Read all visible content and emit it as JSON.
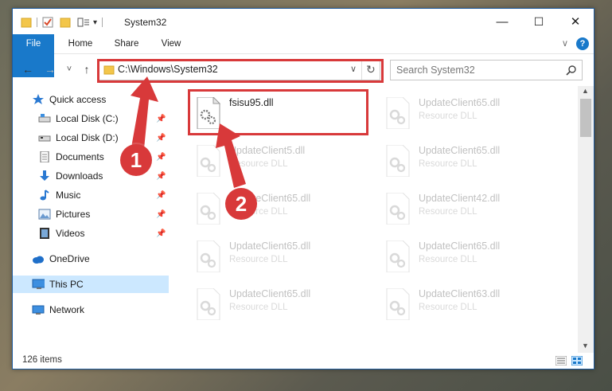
{
  "window": {
    "title": "System32",
    "min_glyph": "—",
    "max_glyph": "☐",
    "close_glyph": "✕"
  },
  "ribbon": {
    "tabs": [
      "File",
      "Home",
      "Share",
      "View"
    ],
    "chevron": "∨",
    "help": "?"
  },
  "nav": {
    "back": "←",
    "forward": "→",
    "recent": "˅",
    "up": "↑",
    "address": "C:\\Windows\\System32",
    "address_dropdown": "∨",
    "refresh": "↻",
    "search_placeholder": "Search System32"
  },
  "sidebar": {
    "items": [
      {
        "label": "Quick access",
        "icon": "star-icon"
      },
      {
        "label": "Local Disk (C:)",
        "icon": "drive-icon",
        "pinned": true
      },
      {
        "label": "Local Disk (D:)",
        "icon": "drive-icon",
        "pinned": true
      },
      {
        "label": "Documents",
        "icon": "documents-icon",
        "pinned": true
      },
      {
        "label": "Downloads",
        "icon": "download-icon",
        "pinned": true
      },
      {
        "label": "Music",
        "icon": "music-icon",
        "pinned": true
      },
      {
        "label": "Pictures",
        "icon": "pictures-icon",
        "pinned": true
      },
      {
        "label": "Videos",
        "icon": "videos-icon",
        "pinned": true
      },
      {
        "label": "OneDrive",
        "icon": "cloud-icon"
      },
      {
        "label": "This PC",
        "icon": "computer-icon",
        "selected": true
      },
      {
        "label": "Network",
        "icon": "network-icon"
      }
    ]
  },
  "files": [
    {
      "name": "fsisu95.dll",
      "type": ""
    },
    {
      "name": "UpdateClient65.dll",
      "type": "Resource DLL"
    },
    {
      "name": "UpdateClient5.dll",
      "type": "Resource DLL"
    },
    {
      "name": "UpdateClient65.dll",
      "type": "Resource DLL"
    },
    {
      "name": "UpdateClient65.dll",
      "type": "Resource DLL"
    },
    {
      "name": "UpdateClient42.dll",
      "type": "Resource DLL"
    },
    {
      "name": "UpdateClient65.dll",
      "type": "Resource DLL"
    },
    {
      "name": "UpdateClient65.dll",
      "type": "Resource DLL"
    },
    {
      "name": "UpdateClient65.dll",
      "type": "Resource DLL"
    },
    {
      "name": "UpdateClient63.dll",
      "type": "Resource DLL"
    }
  ],
  "status": {
    "items": "126 items"
  },
  "callouts": {
    "one": "1",
    "two": "2"
  },
  "colors": {
    "accent": "#1979ca",
    "highlight": "#d8393a",
    "selected": "#cce8ff"
  }
}
